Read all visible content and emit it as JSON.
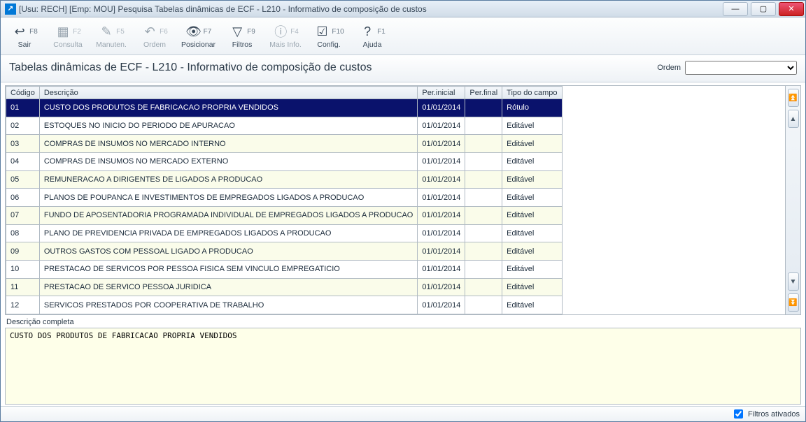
{
  "window": {
    "title": "[Usu: RECH] [Emp: MOU] Pesquisa Tabelas dinâmicas de ECF - L210 - Informativo de composição de custos"
  },
  "toolbar": {
    "items": [
      {
        "label": "Sair",
        "key": "F8",
        "icon": "↩",
        "disabled": false
      },
      {
        "label": "Consulta",
        "key": "F2",
        "icon": "▦",
        "disabled": true
      },
      {
        "label": "Manuten.",
        "key": "F5",
        "icon": "✎",
        "disabled": true
      },
      {
        "label": "Ordem",
        "key": "F6",
        "icon": "↶",
        "disabled": true
      },
      {
        "label": "Posicionar",
        "key": "F7",
        "icon": "👁",
        "disabled": false
      },
      {
        "label": "Filtros",
        "key": "F9",
        "icon": "▽",
        "disabled": false
      },
      {
        "label": "Mais Info.",
        "key": "F4",
        "icon": "ⓘ",
        "disabled": true
      },
      {
        "label": "Config.",
        "key": "F10",
        "icon": "☑",
        "disabled": false
      },
      {
        "label": "Ajuda",
        "key": "F1",
        "icon": "?",
        "disabled": false
      }
    ]
  },
  "page": {
    "title": "Tabelas dinâmicas de ECF - L210 - Informativo de composição de custos",
    "ordem_label": "Ordem",
    "ordem_value": ""
  },
  "grid": {
    "columns": [
      {
        "header": "Código"
      },
      {
        "header": "Descrição"
      },
      {
        "header": "Per.inicial"
      },
      {
        "header": "Per.final"
      },
      {
        "header": "Tipo do campo"
      }
    ],
    "rows": [
      {
        "codigo": "01",
        "descricao": "CUSTO DOS PRODUTOS DE FABRICACAO PROPRIA VENDIDOS",
        "per_inicial": "01/01/2014",
        "per_final": "",
        "tipo": "Rótulo",
        "selected": true
      },
      {
        "codigo": "02",
        "descricao": "ESTOQUES NO INICIO DO PERIODO DE APURACAO",
        "per_inicial": "01/01/2014",
        "per_final": "",
        "tipo": "Editável",
        "selected": false
      },
      {
        "codigo": "03",
        "descricao": "COMPRAS DE INSUMOS NO MERCADO INTERNO",
        "per_inicial": "01/01/2014",
        "per_final": "",
        "tipo": "Editável",
        "selected": false
      },
      {
        "codigo": "04",
        "descricao": "COMPRAS DE INSUMOS NO MERCADO EXTERNO",
        "per_inicial": "01/01/2014",
        "per_final": "",
        "tipo": "Editável",
        "selected": false
      },
      {
        "codigo": "05",
        "descricao": "REMUNERACAO A DIRIGENTES DE LIGADOS A PRODUCAO",
        "per_inicial": "01/01/2014",
        "per_final": "",
        "tipo": "Editável",
        "selected": false
      },
      {
        "codigo": "06",
        "descricao": "PLANOS DE POUPANCA E INVESTIMENTOS DE EMPREGADOS LIGADOS A PRODUCAO",
        "per_inicial": "01/01/2014",
        "per_final": "",
        "tipo": "Editável",
        "selected": false
      },
      {
        "codigo": "07",
        "descricao": "FUNDO DE APOSENTADORIA PROGRAMADA INDIVIDUAL DE EMPREGADOS LIGADOS A PRODUCAO",
        "per_inicial": "01/01/2014",
        "per_final": "",
        "tipo": "Editável",
        "selected": false
      },
      {
        "codigo": "08",
        "descricao": "PLANO DE PREVIDENCIA PRIVADA DE EMPREGADOS LIGADOS A PRODUCAO",
        "per_inicial": "01/01/2014",
        "per_final": "",
        "tipo": "Editável",
        "selected": false
      },
      {
        "codigo": "09",
        "descricao": "OUTROS GASTOS COM PESSOAL LIGADO A PRODUCAO",
        "per_inicial": "01/01/2014",
        "per_final": "",
        "tipo": "Editável",
        "selected": false
      },
      {
        "codigo": "10",
        "descricao": "PRESTACAO DE SERVICOS POR PESSOA FISICA SEM VINCULO EMPREGATICIO",
        "per_inicial": "01/01/2014",
        "per_final": "",
        "tipo": "Editável",
        "selected": false
      },
      {
        "codigo": "11",
        "descricao": "PRESTACAO DE SERVICO PESSOA JURIDICA",
        "per_inicial": "01/01/2014",
        "per_final": "",
        "tipo": "Editável",
        "selected": false
      },
      {
        "codigo": "12",
        "descricao": "SERVICOS PRESTADOS POR COOPERATIVA DE TRABALHO",
        "per_inicial": "01/01/2014",
        "per_final": "",
        "tipo": "Editável",
        "selected": false
      }
    ]
  },
  "description": {
    "label": "Descrição completa",
    "text": "CUSTO DOS PRODUTOS DE FABRICACAO PROPRIA VENDIDOS"
  },
  "status": {
    "filtros_label": "Filtros ativados",
    "filtros_checked": true
  }
}
